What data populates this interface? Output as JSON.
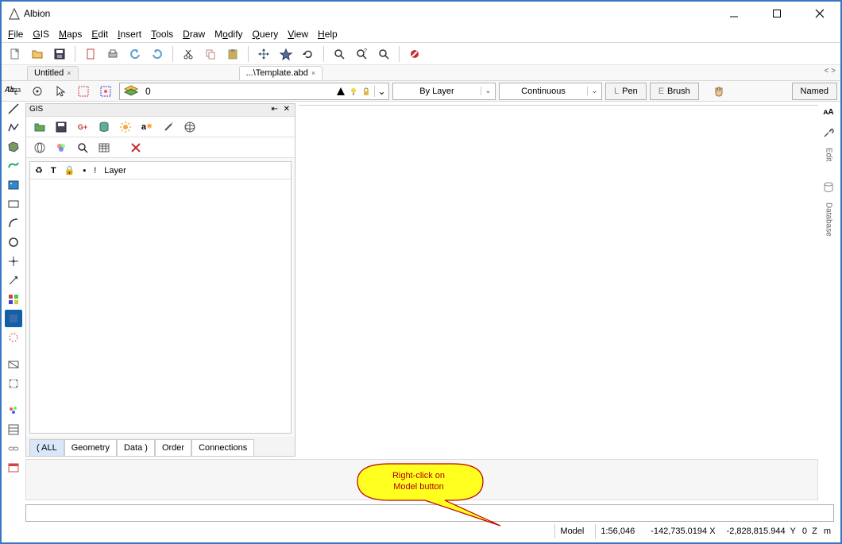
{
  "app": {
    "title": "Albion"
  },
  "menu": {
    "file": "File",
    "gis": "GIS",
    "maps": "Maps",
    "edit": "Edit",
    "insert": "Insert",
    "tools": "Tools",
    "draw": "Draw",
    "modify": "Modify",
    "query": "Query",
    "view": "View",
    "help": "Help"
  },
  "tabs": {
    "t1": "Untitled",
    "t2": "...\\Template.abd"
  },
  "props": {
    "layer_value": "0",
    "color_combo": "By Layer",
    "line_combo": "Continuous",
    "pen_prefix": "L",
    "pen_label": "Pen",
    "brush_prefix": "E",
    "brush_label": "Brush",
    "named": "Named"
  },
  "gis": {
    "title": "GIS",
    "layer_col": "Layer",
    "tab_all": "( ALL",
    "tab_geom": "Geometry",
    "tab_data": "Data )",
    "tab_order": "Order",
    "tab_conn": "Connections"
  },
  "right": {
    "edit": "Edit",
    "database": "Database"
  },
  "status": {
    "model": "Model",
    "scale": "1:56,046",
    "x_val": "-142,735.0194",
    "x_lbl": "X",
    "y_val": "-2,828,815.944",
    "y_lbl": "Y",
    "z_val": "0",
    "z_lbl": "Z",
    "unit": "m"
  },
  "callout": {
    "line1": "Right-click on",
    "line2": "Model button"
  }
}
